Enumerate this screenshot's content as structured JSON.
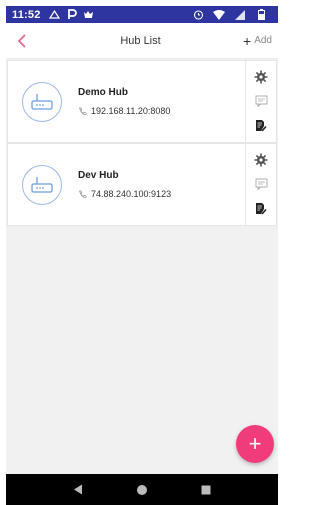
{
  "status_bar": {
    "time": "11:52",
    "left_icons": [
      "navigation-icon",
      "parking-icon",
      "app-icon"
    ],
    "right_icons": [
      "alarm-icon",
      "wifi-icon",
      "signal-icon",
      "battery-icon"
    ]
  },
  "header": {
    "title": "Hub List",
    "add_label": "Add"
  },
  "hubs": [
    {
      "name": "Demo Hub",
      "address": "192.168.11.20:8080"
    },
    {
      "name": "Dev Hub",
      "address": "74.88.240.100:9123"
    }
  ],
  "colors": {
    "status_bar": "#2e35a0",
    "accent": "#e56a8c",
    "fab": "#f03c7a",
    "avatar_border": "#9db8e8"
  },
  "fab": {
    "label": "+"
  }
}
